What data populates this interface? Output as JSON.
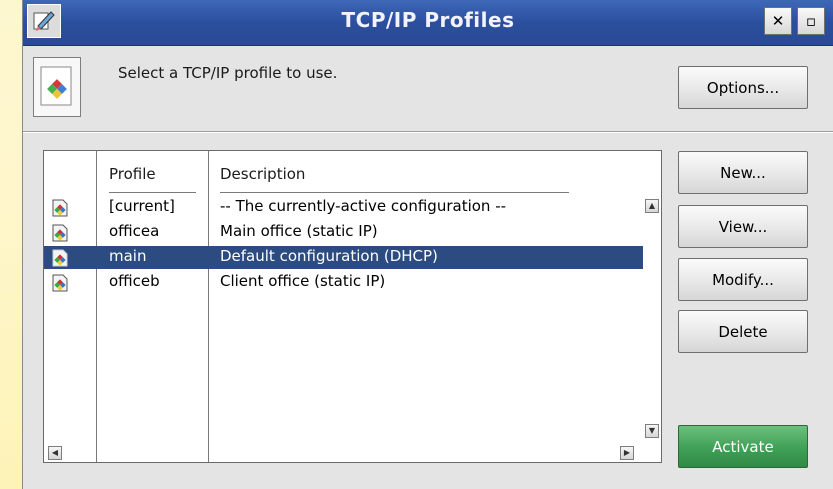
{
  "window": {
    "title": "TCP/IP Profiles",
    "close_label": "✕",
    "restore_label": "▫"
  },
  "header": {
    "prompt": "Select a TCP/IP profile to use.",
    "options_button": "Options..."
  },
  "table": {
    "columns": [
      "Profile",
      "Description"
    ],
    "rows": [
      {
        "profile": "[current]",
        "description": "-- The currently-active configuration --",
        "selected": false
      },
      {
        "profile": "officea",
        "description": "Main office (static IP)",
        "selected": false
      },
      {
        "profile": "main",
        "description": "Default configuration (DHCP)",
        "selected": true
      },
      {
        "profile": "officeb",
        "description": "Client office (static IP)",
        "selected": false
      }
    ]
  },
  "buttons": {
    "new": "New...",
    "view": "View...",
    "modify": "Modify...",
    "delete": "Delete",
    "activate": "Activate"
  },
  "colors": {
    "titlebar": "#2b4f9e",
    "selection": "#2c4b80",
    "activate": "#3fa056"
  }
}
